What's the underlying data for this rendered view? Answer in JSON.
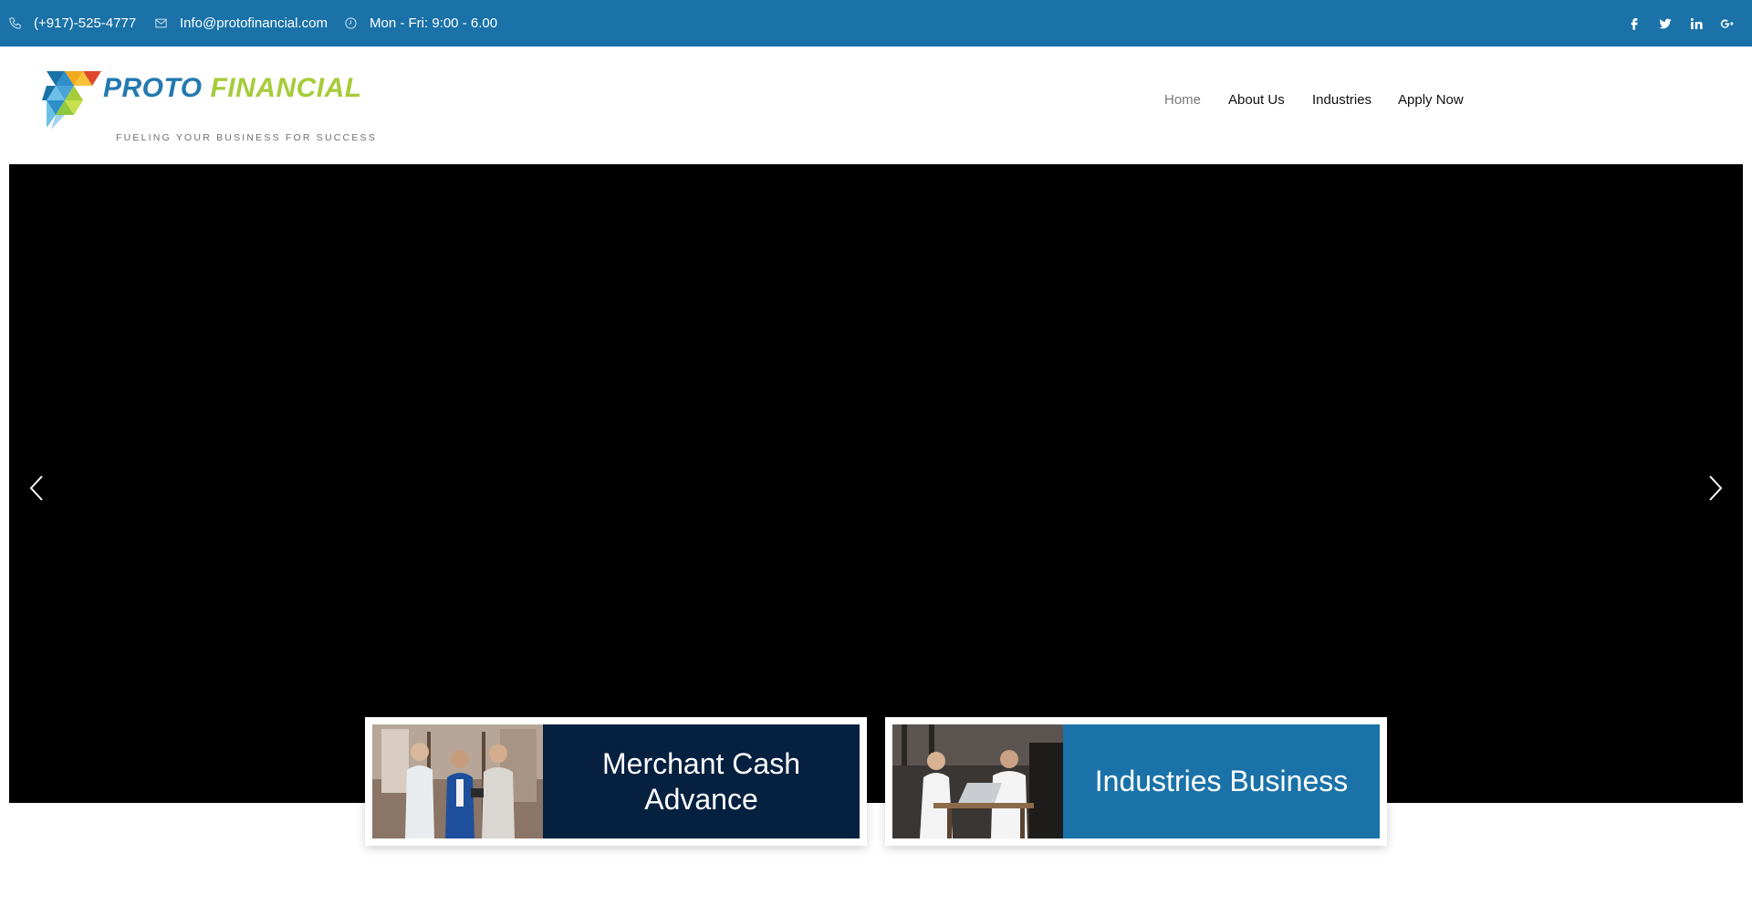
{
  "topbar": {
    "phone": "(+917)-525-4777",
    "email": "Info@protofinancial.com",
    "hours": "Mon - Fri: 9:00 - 6.00",
    "social": [
      "facebook-icon",
      "twitter-icon",
      "linkedin-icon",
      "google-plus-icon"
    ],
    "bg_color": "#1a72a8"
  },
  "logo": {
    "title_part1": "PROTO",
    "title_part2": "FINANCIAL",
    "tagline": "FUELING YOUR BUSINESS FOR SUCCESS",
    "color_primary": "#2379b0",
    "color_accent": "#a6cc3a"
  },
  "nav": {
    "items": [
      {
        "label": "Home",
        "active": true
      },
      {
        "label": "About Us",
        "active": false
      },
      {
        "label": "Industries",
        "active": false
      },
      {
        "label": "Apply Now",
        "active": false
      }
    ]
  },
  "hero": {
    "prev_icon": "chevron-left-icon",
    "next_icon": "chevron-right-icon"
  },
  "cards": [
    {
      "title": "Merchant Cash Advance",
      "panel_color": "#06203f"
    },
    {
      "title": "Industries Business",
      "panel_color": "#1a72a8"
    }
  ]
}
